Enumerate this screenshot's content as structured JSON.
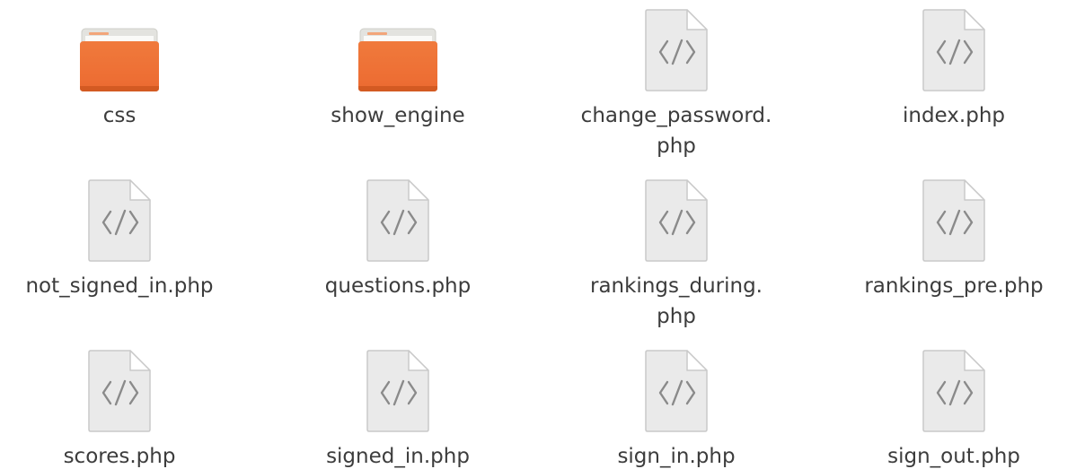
{
  "colors": {
    "folder_front": "#ec6a31",
    "folder_back": "#e3e3df",
    "folder_tab": "#f2a57a",
    "file_fill": "#eaeaea",
    "file_stroke": "#c9c9c9",
    "file_glyph": "#8a8a8a",
    "label_text": "#3c3c3c"
  },
  "items": [
    {
      "type": "folder",
      "icon": "folder-icon",
      "lines": [
        "css"
      ]
    },
    {
      "type": "folder",
      "icon": "folder-icon",
      "lines": [
        "show_engine"
      ]
    },
    {
      "type": "file",
      "icon": "code-file-icon",
      "lines": [
        "change_password.",
        "php"
      ]
    },
    {
      "type": "file",
      "icon": "code-file-icon",
      "lines": [
        "index.php"
      ]
    },
    {
      "type": "file",
      "icon": "code-file-icon",
      "lines": [
        "not_signed_in.php"
      ]
    },
    {
      "type": "file",
      "icon": "code-file-icon",
      "lines": [
        "questions.php"
      ]
    },
    {
      "type": "file",
      "icon": "code-file-icon",
      "lines": [
        "rankings_during.",
        "php"
      ]
    },
    {
      "type": "file",
      "icon": "code-file-icon",
      "lines": [
        "rankings_pre.php"
      ]
    },
    {
      "type": "file",
      "icon": "code-file-icon",
      "lines": [
        "scores.php"
      ]
    },
    {
      "type": "file",
      "icon": "code-file-icon",
      "lines": [
        "signed_in.php"
      ]
    },
    {
      "type": "file",
      "icon": "code-file-icon",
      "lines": [
        "sign_in.php"
      ]
    },
    {
      "type": "file",
      "icon": "code-file-icon",
      "lines": [
        "sign_out.php"
      ]
    }
  ]
}
